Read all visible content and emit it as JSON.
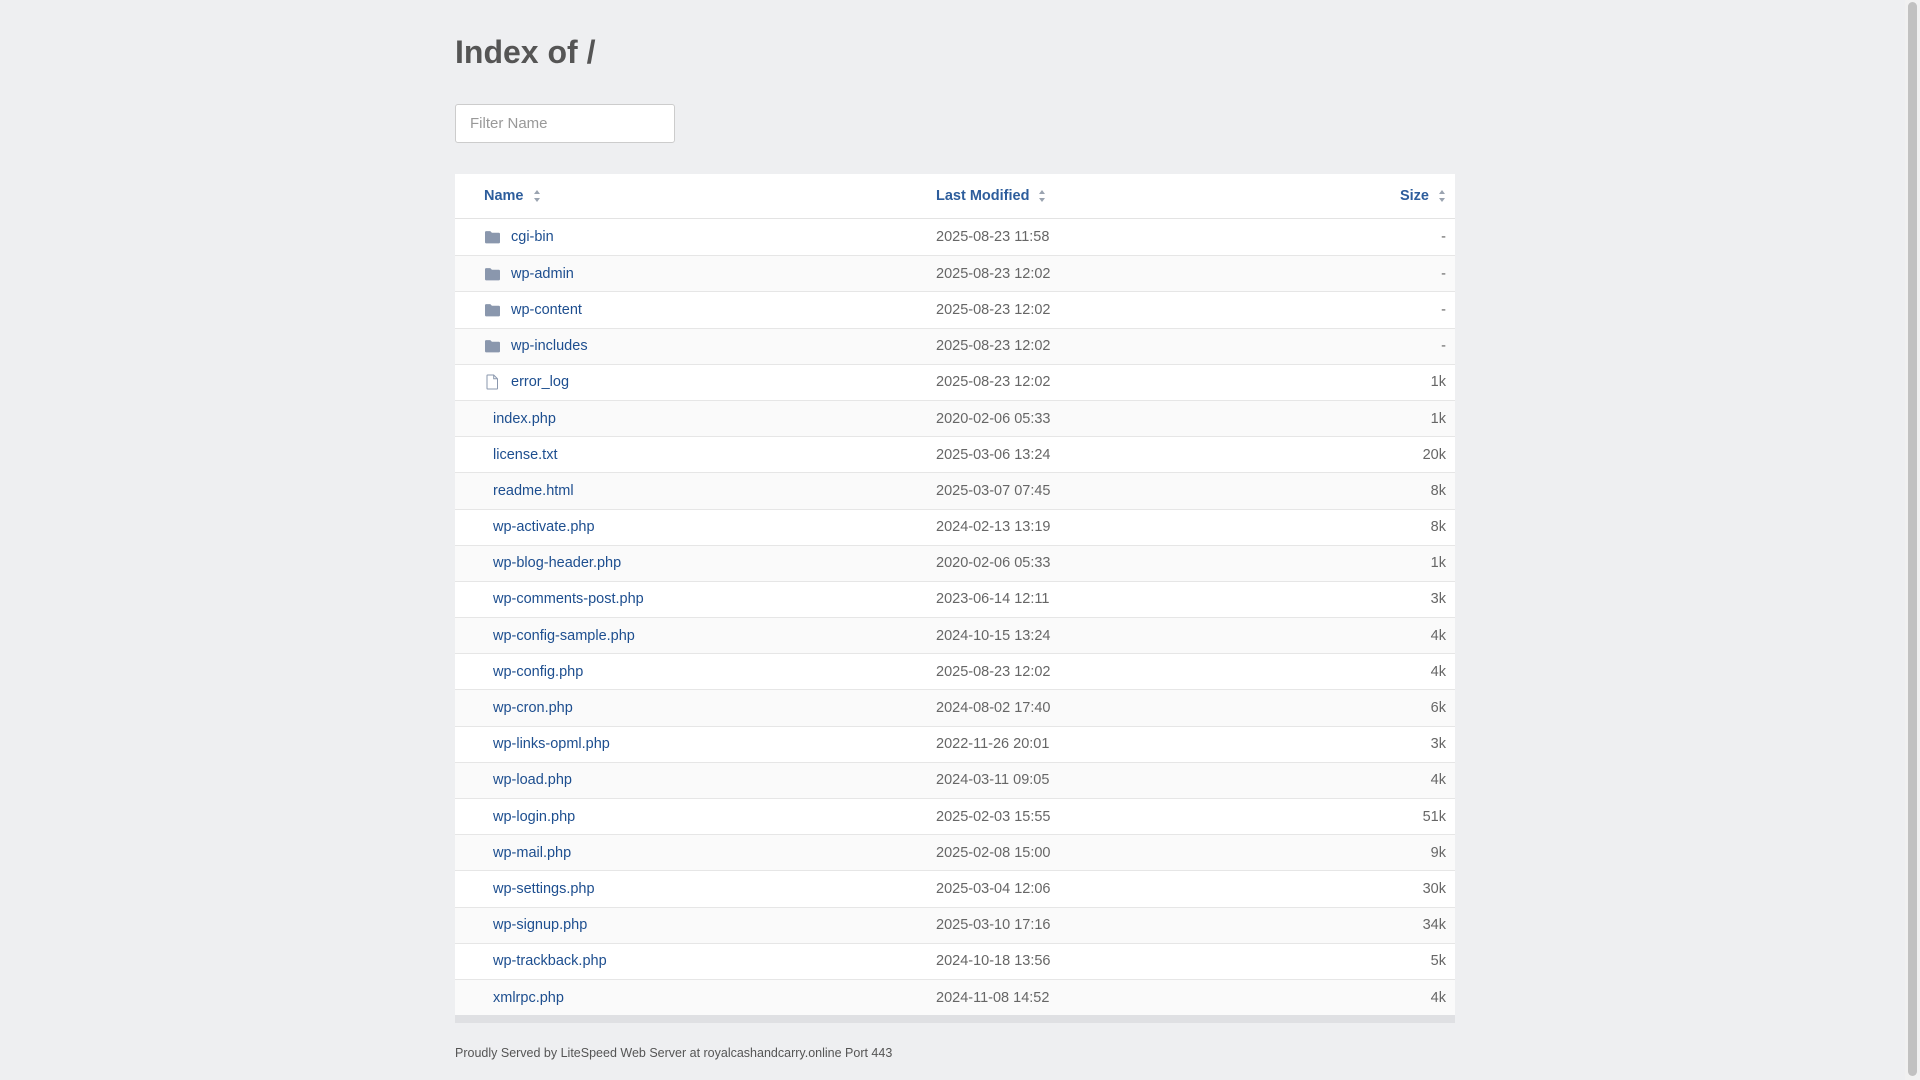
{
  "title": "Index of /",
  "filter": {
    "placeholder": "Filter Name"
  },
  "table": {
    "headers": {
      "name": "Name",
      "modified": "Last Modified",
      "size": "Size"
    },
    "rows": [
      {
        "name": "cgi-bin",
        "modified": "2025-08-23 11:58",
        "size": "-",
        "type": "folder"
      },
      {
        "name": "wp-admin",
        "modified": "2025-08-23 12:02",
        "size": "-",
        "type": "folder"
      },
      {
        "name": "wp-content",
        "modified": "2025-08-23 12:02",
        "size": "-",
        "type": "folder"
      },
      {
        "name": "wp-includes",
        "modified": "2025-08-23 12:02",
        "size": "-",
        "type": "folder"
      },
      {
        "name": "error_log",
        "modified": "2025-08-23 12:02",
        "size": "1k",
        "type": "file"
      },
      {
        "name": "index.php",
        "modified": "2020-02-06 05:33",
        "size": "1k",
        "type": "none"
      },
      {
        "name": "license.txt",
        "modified": "2025-03-06 13:24",
        "size": "20k",
        "type": "none"
      },
      {
        "name": "readme.html",
        "modified": "2025-03-07 07:45",
        "size": "8k",
        "type": "none"
      },
      {
        "name": "wp-activate.php",
        "modified": "2024-02-13 13:19",
        "size": "8k",
        "type": "none"
      },
      {
        "name": "wp-blog-header.php",
        "modified": "2020-02-06 05:33",
        "size": "1k",
        "type": "none"
      },
      {
        "name": "wp-comments-post.php",
        "modified": "2023-06-14 12:11",
        "size": "3k",
        "type": "none"
      },
      {
        "name": "wp-config-sample.php",
        "modified": "2024-10-15 13:24",
        "size": "4k",
        "type": "none"
      },
      {
        "name": "wp-config.php",
        "modified": "2025-08-23 12:02",
        "size": "4k",
        "type": "none"
      },
      {
        "name": "wp-cron.php",
        "modified": "2024-08-02 17:40",
        "size": "6k",
        "type": "none"
      },
      {
        "name": "wp-links-opml.php",
        "modified": "2022-11-26 20:01",
        "size": "3k",
        "type": "none"
      },
      {
        "name": "wp-load.php",
        "modified": "2024-03-11 09:05",
        "size": "4k",
        "type": "none"
      },
      {
        "name": "wp-login.php",
        "modified": "2025-02-03 15:55",
        "size": "51k",
        "type": "none"
      },
      {
        "name": "wp-mail.php",
        "modified": "2025-02-08 15:00",
        "size": "9k",
        "type": "none"
      },
      {
        "name": "wp-settings.php",
        "modified": "2025-03-04 12:06",
        "size": "30k",
        "type": "none"
      },
      {
        "name": "wp-signup.php",
        "modified": "2025-03-10 17:16",
        "size": "34k",
        "type": "none"
      },
      {
        "name": "wp-trackback.php",
        "modified": "2024-10-18 13:56",
        "size": "5k",
        "type": "none"
      },
      {
        "name": "xmlrpc.php",
        "modified": "2024-11-08 14:52",
        "size": "4k",
        "type": "none"
      }
    ]
  },
  "footer": "Proudly Served by LiteSpeed Web Server at royalcashandcarry.online Port 443",
  "colors": {
    "link": "#1d4e8f",
    "header_link": "#2d5d9c",
    "icon": "#8a97ad",
    "background": "#eeeff1"
  }
}
